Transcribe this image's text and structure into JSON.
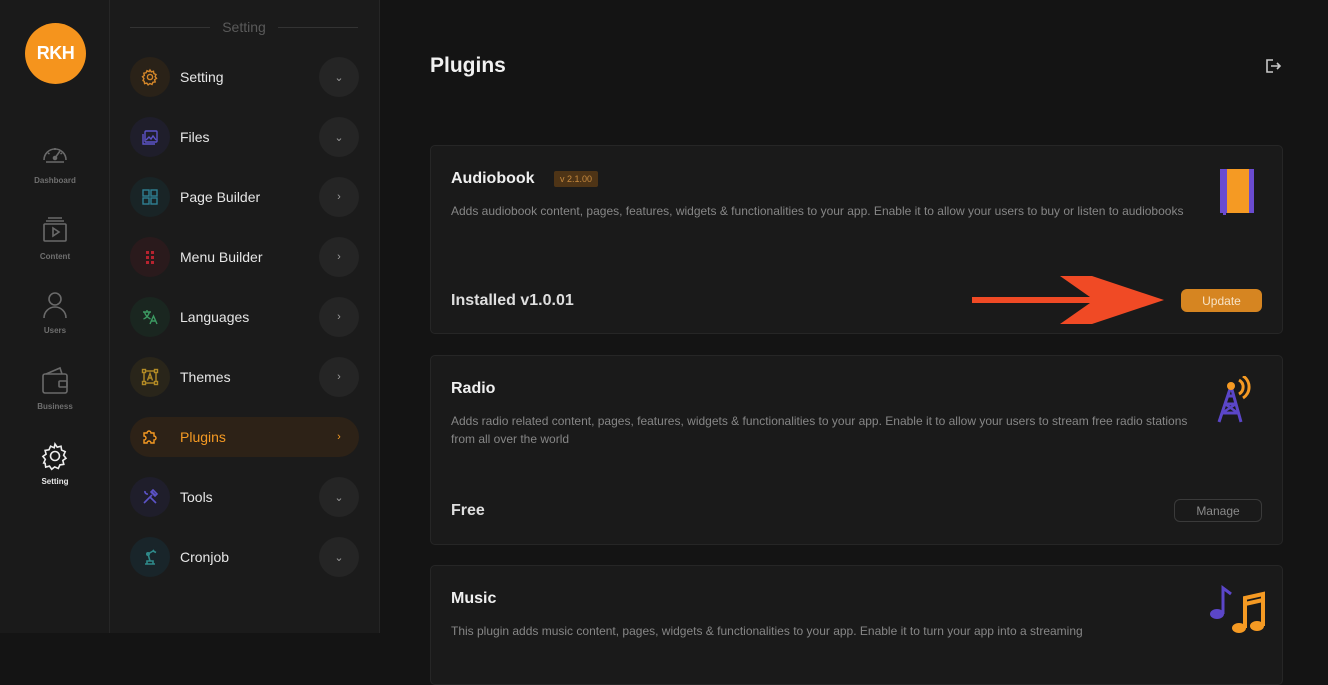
{
  "app": {
    "logo_text": "RKH"
  },
  "rail": {
    "items": [
      {
        "label": "Dashboard",
        "icon": "gauge-icon",
        "active": false
      },
      {
        "label": "Content",
        "icon": "video-stack-icon",
        "active": false
      },
      {
        "label": "Users",
        "icon": "user-icon",
        "active": false
      },
      {
        "label": "Business",
        "icon": "wallet-icon",
        "active": false
      },
      {
        "label": "Setting",
        "icon": "gear-icon",
        "active": true
      }
    ]
  },
  "submenu": {
    "header": "Setting",
    "items": [
      {
        "label": "Setting",
        "icon": "gear-icon",
        "color": "#d5872a",
        "bg": "#2a2218",
        "chevron": "down"
      },
      {
        "label": "Files",
        "icon": "image-gallery-icon",
        "color": "#5c53c7",
        "bg": "#1f1e2b",
        "chevron": "down"
      },
      {
        "label": "Page Builder",
        "icon": "grid-icon",
        "color": "#2f7f93",
        "bg": "#192426",
        "chevron": "right"
      },
      {
        "label": "Menu Builder",
        "icon": "dots-grid-icon",
        "color": "#b8232f",
        "bg": "#2a1a1c",
        "chevron": "right"
      },
      {
        "label": "Languages",
        "icon": "translate-icon",
        "color": "#3c9a62",
        "bg": "#1a2620",
        "chevron": "right"
      },
      {
        "label": "Themes",
        "icon": "text-frame-icon",
        "color": "#b38b26",
        "bg": "#29251a",
        "chevron": "right"
      },
      {
        "label": "Plugins",
        "icon": "puzzle-icon",
        "color": "#f59a23",
        "bg": "transparent",
        "chevron": "right",
        "active": true
      },
      {
        "label": "Tools",
        "icon": "tools-icon",
        "color": "#5c53c7",
        "bg": "#1f1e2b",
        "chevron": "down"
      },
      {
        "label": "Cronjob",
        "icon": "robot-arm-icon",
        "color": "#2f8a8a",
        "bg": "#19252a",
        "chevron": "down"
      }
    ]
  },
  "main": {
    "title": "Plugins",
    "logout_icon": "logout-icon",
    "plugins": [
      {
        "name": "Audiobook",
        "version": "v 2.1.00",
        "description": "Adds audiobook content, pages, features, widgets & functionalities to your app. Enable it to allow your users to buy or listen to audiobooks",
        "status": "Installed v1.0.01",
        "button": "Update",
        "icon": "notebook-icon"
      },
      {
        "name": "Radio",
        "description": "Adds radio related content, pages, features, widgets & functionalities to your app. Enable it to allow your users to stream free radio stations from all over the world",
        "status": "Free",
        "button": "Manage",
        "icon": "radio-tower-icon"
      },
      {
        "name": "Music",
        "description": "This plugin adds music content, pages, widgets & functionalities to your app. Enable it to turn your app into a streaming",
        "icon": "music-notes-icon"
      }
    ]
  },
  "annotation": {
    "icon": "red-arrow-icon",
    "color": "#f04a25"
  }
}
